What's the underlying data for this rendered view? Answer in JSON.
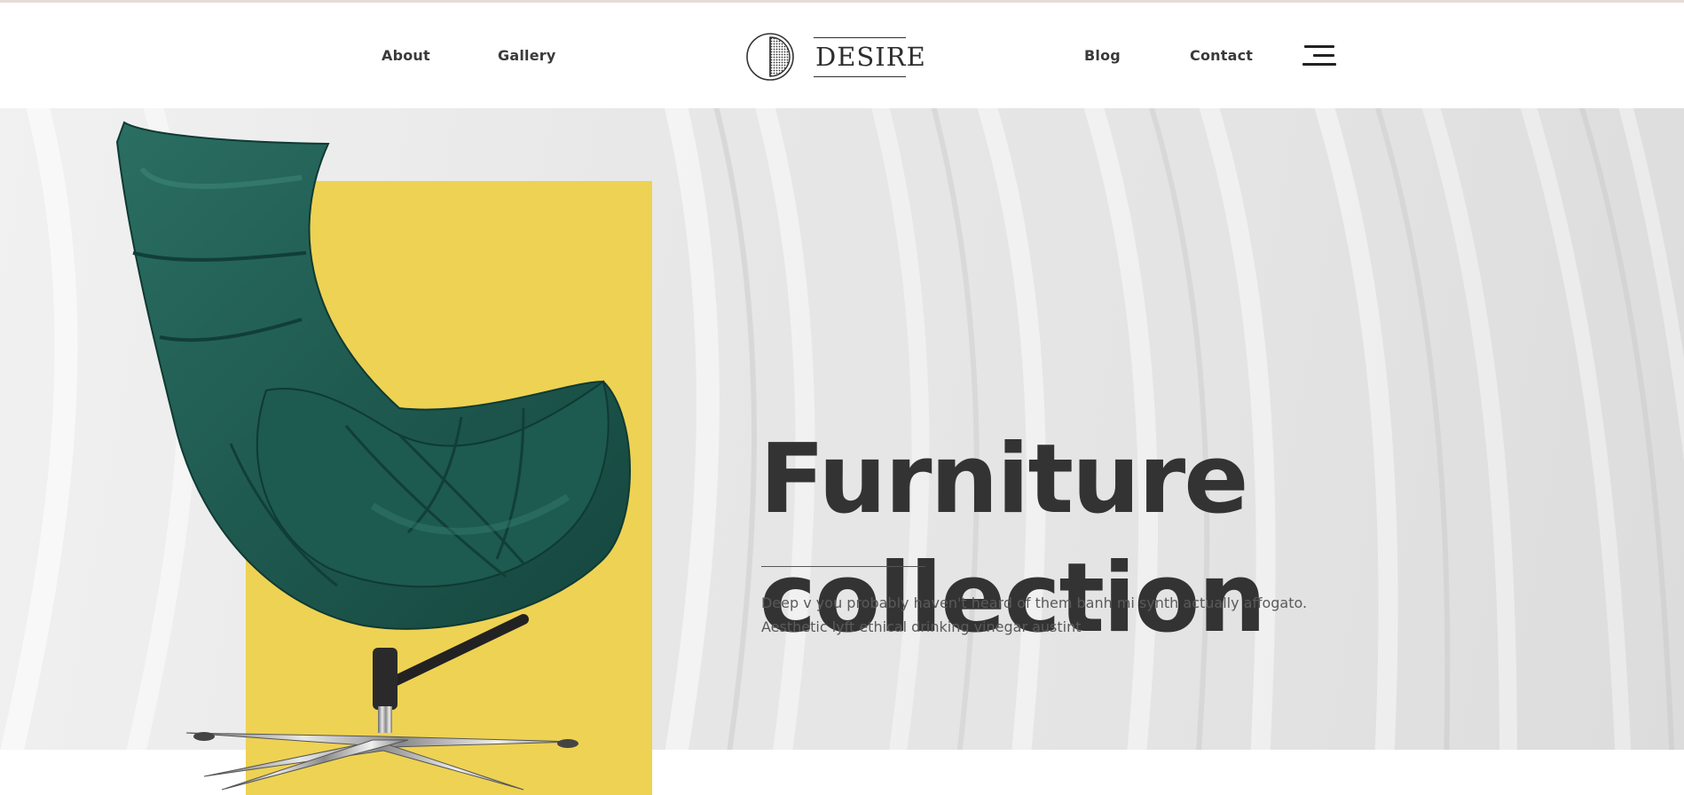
{
  "nav": {
    "left_links": [
      "About",
      "Gallery"
    ],
    "right_links": [
      "Blog",
      "Contact"
    ],
    "logo_text": "DESIRE",
    "menu_icon": "hamburger-menu-icon"
  },
  "hero": {
    "headline_line1": "Furniture",
    "headline_line2": "collection",
    "description_line1": "Deep v you probably haven't heard of them banh mi synth actually affogato.",
    "description_line2": "Aesthetic lyft ethical drinking vinegar austint",
    "image": "green-leather-egg-chair",
    "accent_block_color": "#eed253",
    "chair_color": "#1f5a50"
  },
  "colors": {
    "text_dark": "#333333",
    "text_body": "#5a5a5a",
    "hero_background": "#e6e6e6",
    "top_rule": "#e6dcd6"
  }
}
